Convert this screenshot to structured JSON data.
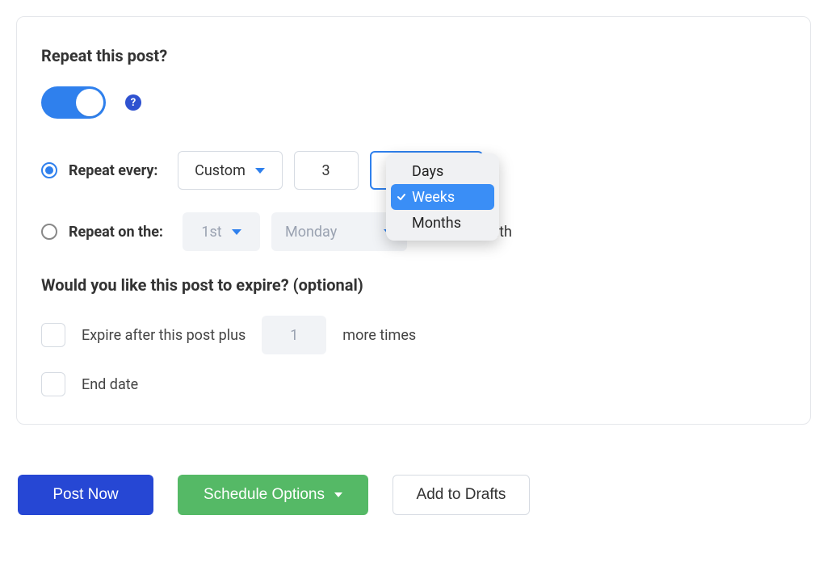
{
  "card": {
    "title": "Repeat this post?",
    "toggle_on": true,
    "repeat_every": {
      "label": "Repeat every:",
      "interval_type_label": "Custom",
      "count": "3",
      "unit_options": [
        "Days",
        "Weeks",
        "Months"
      ],
      "unit_selected": "Weeks"
    },
    "repeat_on": {
      "label": "Repeat on the:",
      "ordinal": "1st",
      "weekday": "Monday",
      "suffix": "of each month"
    },
    "expire": {
      "title": "Would you like this post to expire? (optional)",
      "after_prefix": "Expire after this post plus",
      "after_count": "1",
      "after_suffix": "more times",
      "end_date_label": "End date"
    }
  },
  "footer": {
    "post_now": "Post Now",
    "schedule_options": "Schedule Options",
    "add_to_drafts": "Add to Drafts"
  }
}
